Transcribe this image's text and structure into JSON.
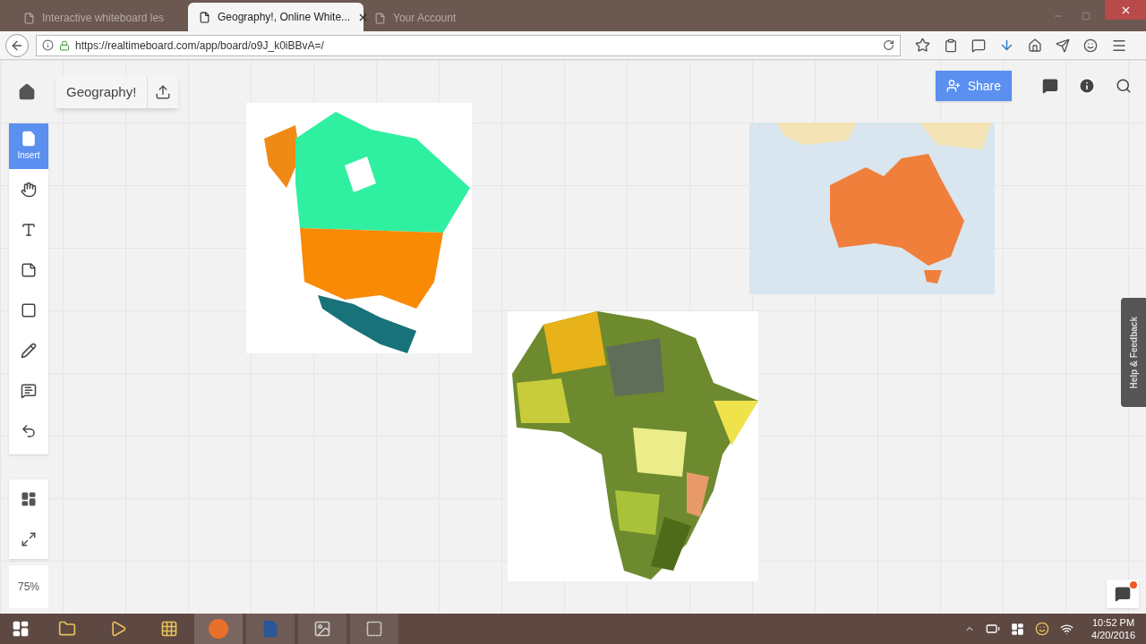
{
  "browser": {
    "tabs": [
      {
        "title": "Interactive whiteboard les",
        "selected": false
      },
      {
        "title": "Geography!, Online White...",
        "selected": true
      },
      {
        "title": "Your Account",
        "selected": false
      }
    ],
    "url": "https://realtimeboard.com/app/board/o9J_k0iBBvA=/"
  },
  "board": {
    "title": "Geography!",
    "share": "Share",
    "tools": [
      {
        "kind": "insert",
        "label": "Insert",
        "selected": true
      },
      {
        "kind": "hand",
        "selected": false
      },
      {
        "kind": "text",
        "selected": false
      },
      {
        "kind": "note",
        "selected": false
      },
      {
        "kind": "shape",
        "selected": false
      },
      {
        "kind": "pen",
        "selected": false
      },
      {
        "kind": "comment",
        "selected": false
      },
      {
        "kind": "undo",
        "selected": false
      }
    ],
    "zoom": "75%",
    "help": "Help & Feedback",
    "chat": {
      "unread": true
    }
  },
  "taskbar": {
    "time": "10:52 PM",
    "date": "4/20/2016"
  }
}
